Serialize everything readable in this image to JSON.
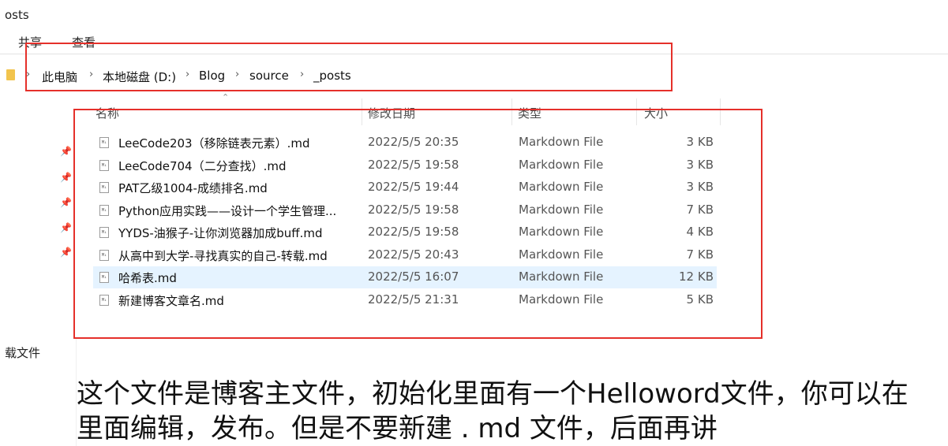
{
  "window": {
    "title_partial": "osts"
  },
  "ribbon": {
    "tabs": [
      "共享",
      "查看"
    ]
  },
  "breadcrumb": [
    "此电脑",
    "本地磁盘 (D:)",
    "Blog",
    "source",
    "_posts"
  ],
  "columns": {
    "name": "名称",
    "date": "修改日期",
    "type": "类型",
    "size": "大小"
  },
  "files": [
    {
      "name": "LeeCode203（移除链表元素）.md",
      "date": "2022/5/5 20:35",
      "type": "Markdown File",
      "size": "3 KB"
    },
    {
      "name": "LeeCode704（二分查找）.md",
      "date": "2022/5/5 19:58",
      "type": "Markdown File",
      "size": "3 KB"
    },
    {
      "name": "PAT乙级1004-成绩排名.md",
      "date": "2022/5/5 19:44",
      "type": "Markdown File",
      "size": "3 KB"
    },
    {
      "name": "Python应用实践——设计一个学生管理...",
      "date": "2022/5/5 19:58",
      "type": "Markdown File",
      "size": "7 KB"
    },
    {
      "name": "YYDS-油猴子-让你浏览器加成buff.md",
      "date": "2022/5/5 19:58",
      "type": "Markdown File",
      "size": "4 KB"
    },
    {
      "name": "从高中到大学-寻找真实的自己-转载.md",
      "date": "2022/5/5 20:43",
      "type": "Markdown File",
      "size": "7 KB"
    },
    {
      "name": "哈希表.md",
      "date": "2022/5/5 16:07",
      "type": "Markdown File",
      "size": "12 KB"
    },
    {
      "name": "新建博客文章名.md",
      "date": "2022/5/5 21:31",
      "type": "Markdown File",
      "size": "5 KB"
    }
  ],
  "file_icon_text": "M↓",
  "sidebar": {
    "partial_label": "载文件"
  },
  "caption": {
    "line1": "这个文件是博客主文件，初始化里面有一个Helloword文件，你可以在",
    "line2": "里面编辑，发布。但是不要新建 . md 文件，后面再讲"
  },
  "colors": {
    "annotation_red": "#e5302a",
    "selected_row": "#e5f3ff"
  }
}
